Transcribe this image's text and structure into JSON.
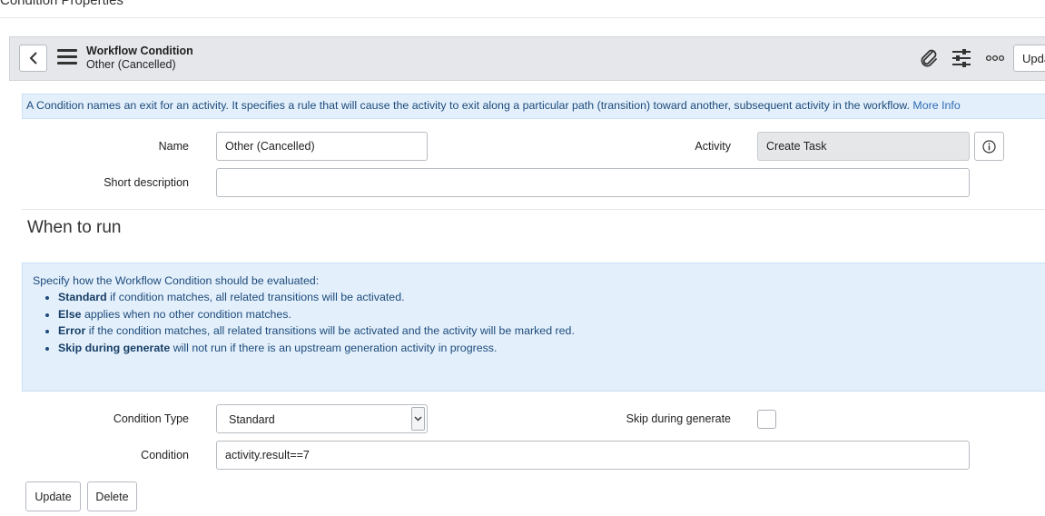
{
  "page": {
    "heading": "Condition Properties"
  },
  "header": {
    "title": "Workflow Condition",
    "subtitle": "Other (Cancelled)",
    "update_label": "Update",
    "icons": [
      "back-icon",
      "hamburger-menu-icon",
      "paperclip-icon",
      "settings-sliders-icon",
      "more-options-icon"
    ]
  },
  "info_bar": {
    "text": "A Condition names an exit for an activity. It specifies a rule that will cause the activity to exit along a particular path (transition) toward another, subsequent activity in the workflow.",
    "link": "More Info"
  },
  "form": {
    "name_label": "Name",
    "name_value": "Other (Cancelled)",
    "activity_label": "Activity",
    "activity_value": "Create Task",
    "short_desc_label": "Short description",
    "short_desc_value": ""
  },
  "section": {
    "title": "When to run"
  },
  "help": {
    "intro": "Specify how the Workflow Condition should be evaluated:",
    "items": [
      {
        "term": "Standard",
        "text": " if condition matches, all related transitions will be activated."
      },
      {
        "term": "Else",
        "text": " applies when no other condition matches."
      },
      {
        "term": "Error",
        "text": " if the condition matches, all related transitions will be activated and the activity will be marked red."
      },
      {
        "term": "Skip during generate",
        "text": " will not run if there is an upstream generation activity in progress."
      }
    ]
  },
  "run": {
    "type_label": "Condition Type",
    "type_value": "Standard",
    "skip_label": "Skip during generate",
    "skip_checked": false,
    "condition_label": "Condition",
    "condition_value": "activity.result==7"
  },
  "footer": {
    "update_label": "Update",
    "delete_label": "Delete"
  }
}
